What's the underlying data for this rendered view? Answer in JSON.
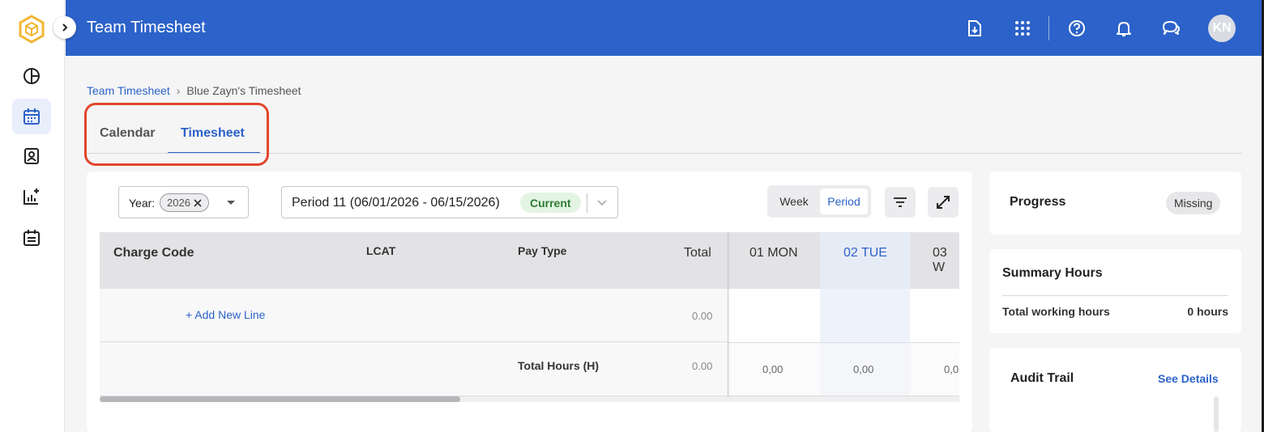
{
  "header": {
    "title": "Team Timesheet",
    "avatar_initials": "KN"
  },
  "breadcrumb": {
    "parent": "Team Timesheet",
    "separator": "›",
    "current": "Blue Zayn's Timesheet"
  },
  "tabs": [
    {
      "label": "Calendar",
      "active": false
    },
    {
      "label": "Timesheet",
      "active": true
    }
  ],
  "filters": {
    "year_label": "Year:",
    "year_value": "2026",
    "period_text": "Period 11 (06/01/2026 - 06/15/2026)",
    "period_badge": "Current"
  },
  "view_toggle": {
    "week": "Week",
    "period": "Period",
    "selected": "Period"
  },
  "table": {
    "headers": {
      "charge_code": "Charge Code",
      "lcat": "LCAT",
      "pay_type": "Pay Type",
      "total": "Total",
      "days": [
        "01 MON",
        "02 TUE",
        "03 W"
      ]
    },
    "add_line": "+ Add New Line",
    "add_line_total": "0.00",
    "total_hours_label": "Total Hours (H)",
    "total_hours_value": "0.00",
    "day_totals": [
      "0,00",
      "0,00",
      "0,0"
    ]
  },
  "progress": {
    "title": "Progress",
    "status": "Missing"
  },
  "summary": {
    "title": "Summary Hours",
    "label": "Total working hours",
    "value": "0 hours"
  },
  "audit": {
    "title": "Audit Trail",
    "link": "See Details"
  },
  "colors": {
    "brand_blue": "#2c62c9",
    "highlight_red": "#e2462d",
    "current_green": "#2e7d32"
  }
}
